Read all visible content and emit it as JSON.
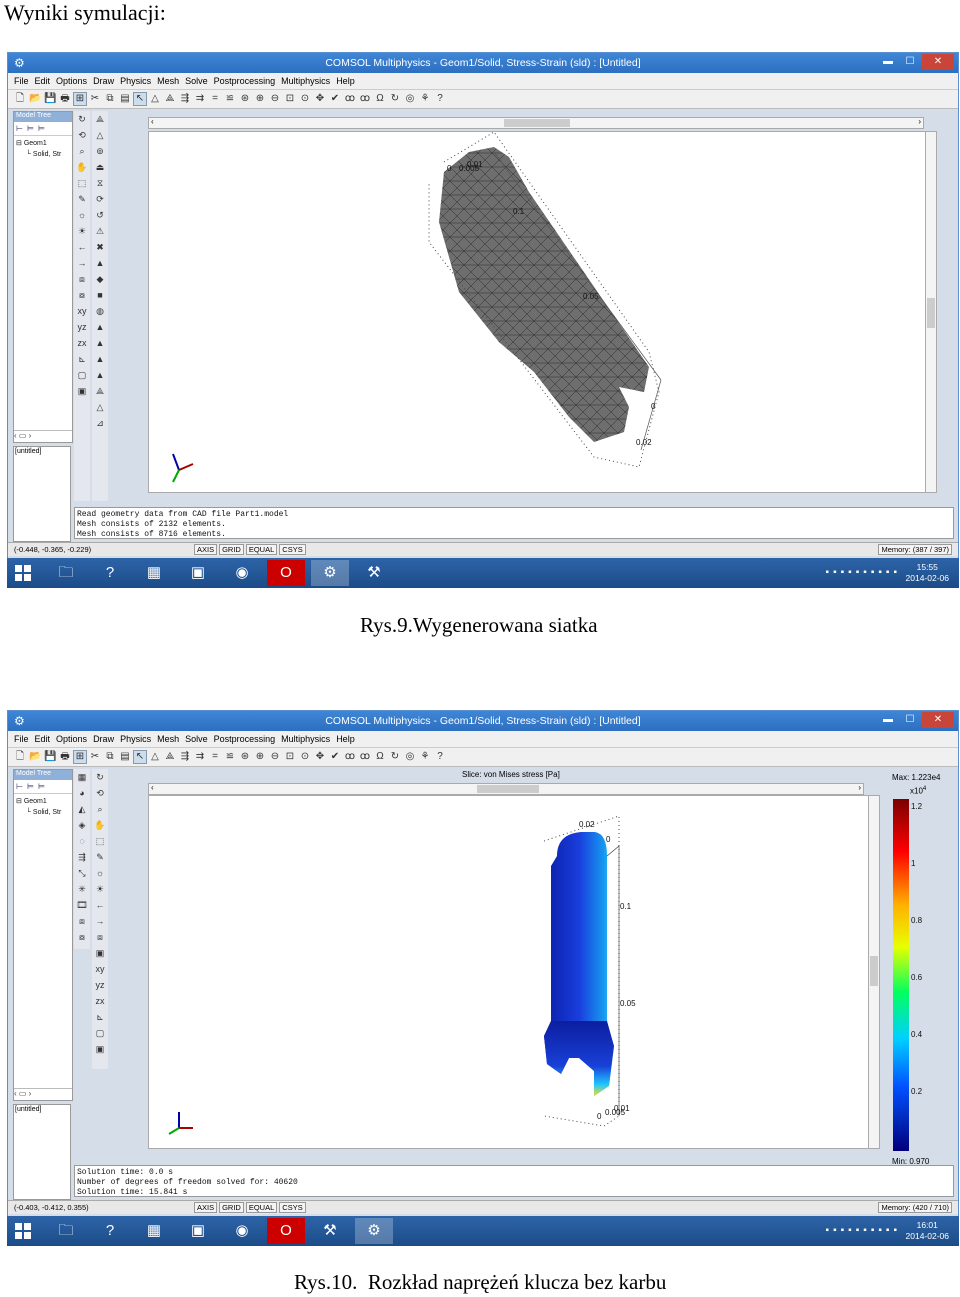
{
  "document": {
    "heading": "Wyniki symulacji:",
    "caption1": "Rys.9.Wygenerowana siatka",
    "caption2": "Rys.10.  Rozkład naprężeń klucza bez karbu"
  },
  "shared": {
    "window_title": "COMSOL Multiphysics - Geom1/Solid, Stress-Strain (sld) : [Untitled]",
    "menu": [
      "File",
      "Edit",
      "Options",
      "Draw",
      "Physics",
      "Mesh",
      "Solve",
      "Postprocessing",
      "Multiphysics",
      "Help"
    ],
    "model_tree_label": "Model Tree",
    "tree_root": "Geom1",
    "tree_child": "Solid, Str",
    "untitled_label": "[untitled]",
    "status_toggles": [
      "AXIS",
      "GRID",
      "EQUAL",
      "CSYS"
    ],
    "colors": {
      "title_bar": "#2d6fc0",
      "taskbar": "#1f5a96",
      "mesh": "#6e6e6e"
    }
  },
  "screen1": {
    "console_lines": [
      "Read geometry data from CAD file Part1.model",
      "Mesh consists of 2132 elements.",
      "Mesh consists of 8716 elements."
    ],
    "coords": "(-0.448, -0.365, -0.229)",
    "memory": "Memory: (387 / 397)",
    "clock_time": "15:55",
    "clock_date": "2014-02-06",
    "axis_labels": [
      "0",
      "0.005",
      "0.01",
      "0.1",
      "0.05",
      "0",
      "0.02"
    ]
  },
  "screen2": {
    "plot_title": "Slice: von Mises stress [Pa]",
    "colorbar_max": "Max: 1.223e4",
    "colorbar_multiplier": "x10",
    "colorbar_exponent": "4",
    "colorbar_ticks": [
      "1.2",
      "1",
      "0.8",
      "0.6",
      "0.4",
      "0.2"
    ],
    "colorbar_min": "Min: 0.970",
    "console_lines": [
      "Solution time: 0.0 s",
      "Number of degrees of freedom solved for: 40620",
      "Solution time: 15.841 s"
    ],
    "coords": "(-0.403, -0.412, 0.355)",
    "memory": "Memory: (420 / 710)",
    "clock_time": "16:01",
    "clock_date": "2014-02-06",
    "axis_labels": [
      "0.02",
      "0",
      "0.1",
      "0.05",
      "0",
      "0.005",
      "0.01"
    ]
  }
}
